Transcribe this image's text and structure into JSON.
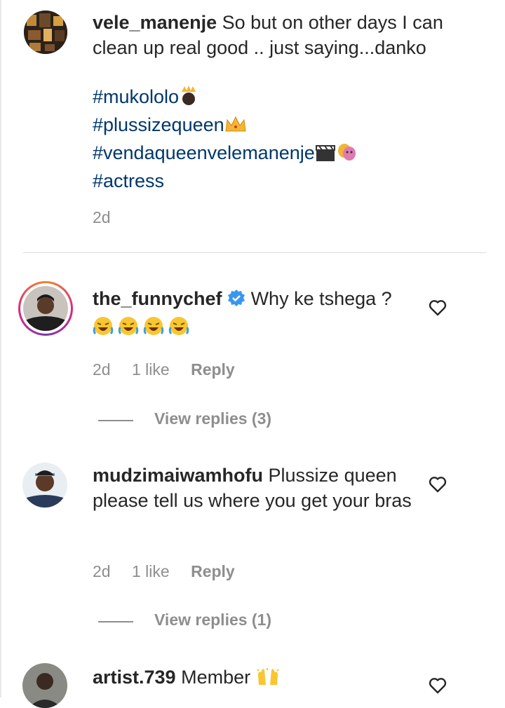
{
  "comments": [
    {
      "username": "vele_manenje",
      "text": "So but on other days I can clean up real good .. just saying...danko",
      "hashtags": [
        "#mukololo",
        "#plussizequeen",
        "#vendaqueenvelemanenje",
        "#actress"
      ],
      "time": "2d"
    },
    {
      "username": "the_funnychef",
      "text": "Why ke tshega ?",
      "time": "2d",
      "likes": "1 like",
      "reply_label": "Reply",
      "view_replies": "View replies (3)"
    },
    {
      "username": "mudzimaiwamhofu",
      "text": "Plussize queen please tell us where you get your bras",
      "time": "2d",
      "likes": "1 like",
      "reply_label": "Reply",
      "view_replies": "View replies (1)"
    },
    {
      "username": "artist.739",
      "text": "Member"
    }
  ],
  "icons": [
    "crown-icon",
    "verified-badge-icon",
    "laughing-emoji-icon",
    "clapper-icon",
    "performing-arts-icon",
    "raising-hands-icon",
    "heart-icon"
  ],
  "colors": {
    "hashtag": "#00376b",
    "muted": "#8e8e8e",
    "verified": "#3897f0",
    "story_ring": "#e1306c"
  }
}
